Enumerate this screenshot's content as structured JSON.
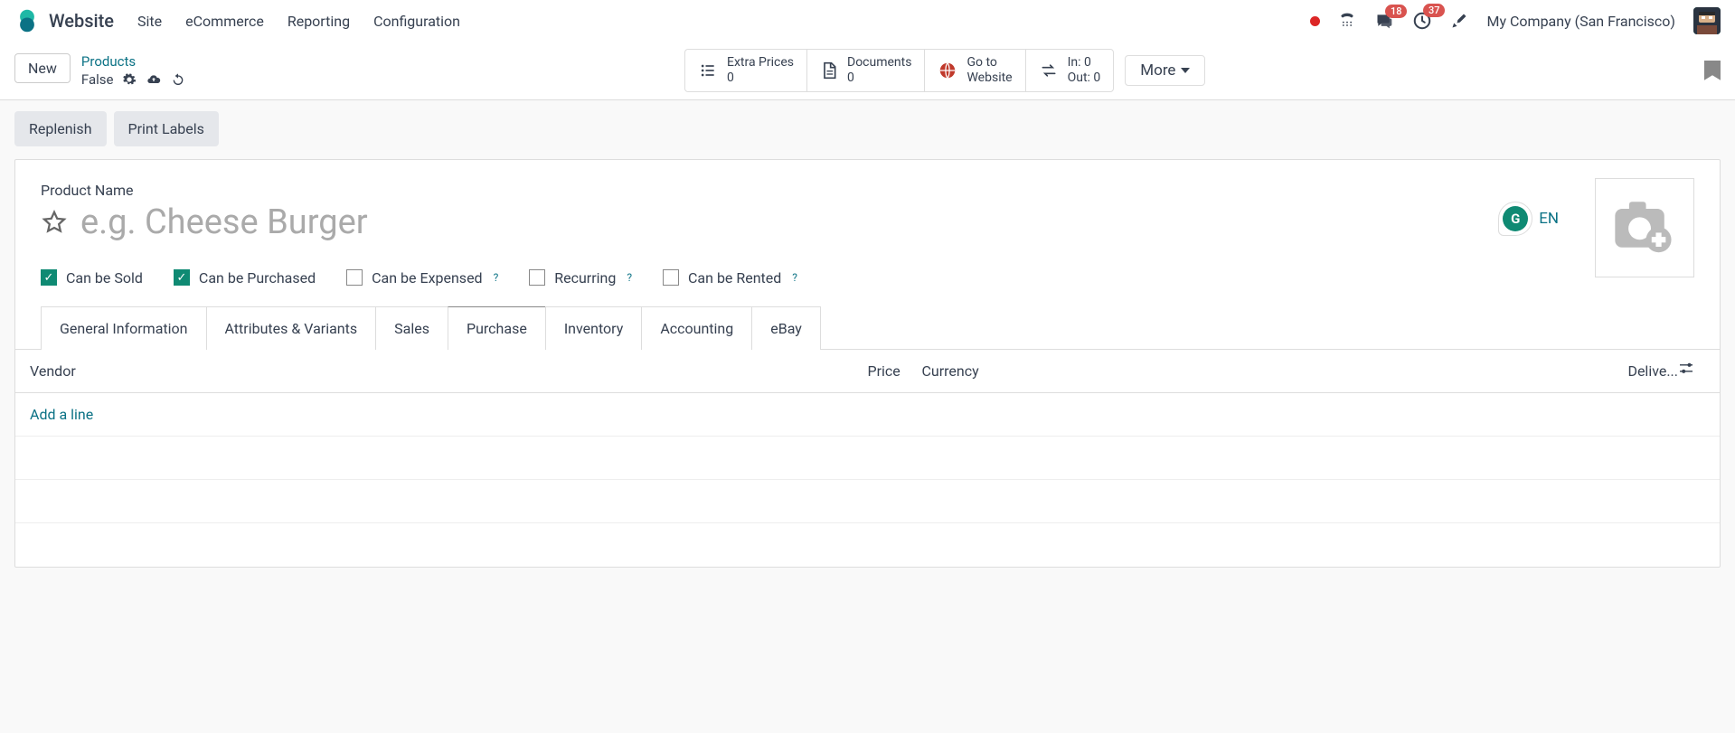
{
  "nav": {
    "app": "Website",
    "items": [
      "Site",
      "eCommerce",
      "Reporting",
      "Configuration"
    ],
    "company": "My Company (San Francisco)",
    "messages_badge": "18",
    "activities_badge": "37"
  },
  "breadcrumb": {
    "new_btn": "New",
    "parent": "Products",
    "status": "False"
  },
  "stats": {
    "extra_prices": {
      "label": "Extra Prices",
      "value": "0"
    },
    "documents": {
      "label": "Documents",
      "value": "0"
    },
    "website": {
      "label1": "Go to",
      "label2": "Website"
    },
    "in": {
      "label": "In:",
      "value": "0"
    },
    "out": {
      "label": "Out:",
      "value": "0"
    },
    "more": "More"
  },
  "actions": {
    "replenish": "Replenish",
    "print_labels": "Print Labels"
  },
  "form": {
    "product_name_label": "Product Name",
    "product_name_placeholder": "e.g. Cheese Burger",
    "lang": "EN",
    "checkboxes": {
      "sold": "Can be Sold",
      "purchased": "Can be Purchased",
      "expensed": "Can be Expensed",
      "recurring": "Recurring",
      "rented": "Can be Rented"
    }
  },
  "tabs": [
    "General Information",
    "Attributes & Variants",
    "Sales",
    "Purchase",
    "Inventory",
    "Accounting",
    "eBay"
  ],
  "active_tab": "Purchase",
  "table": {
    "headers": {
      "vendor": "Vendor",
      "price": "Price",
      "currency": "Currency",
      "delivery": "Delive..."
    },
    "add_line": "Add a line"
  }
}
